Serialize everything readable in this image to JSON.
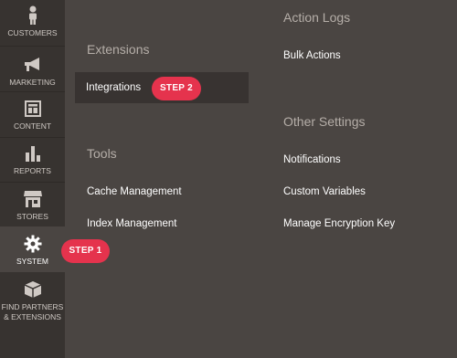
{
  "sidebar": {
    "items": [
      {
        "label": "CUSTOMERS",
        "icon": "person-icon"
      },
      {
        "label": "MARKETING",
        "icon": "megaphone-icon"
      },
      {
        "label": "CONTENT",
        "icon": "layout-icon"
      },
      {
        "label": "REPORTS",
        "icon": "bar-chart-icon"
      },
      {
        "label": "STORES",
        "icon": "storefront-icon"
      },
      {
        "label": "SYSTEM",
        "icon": "gear-icon"
      },
      {
        "label_line1": "FIND PARTNERS",
        "label_line2": "& EXTENSIONS",
        "icon": "box-icon"
      }
    ]
  },
  "panel": {
    "extensions": {
      "heading": "Extensions",
      "items": [
        "Integrations"
      ]
    },
    "tools": {
      "heading": "Tools",
      "items": [
        "Cache Management",
        "Index Management"
      ]
    },
    "action_logs": {
      "heading": "Action Logs",
      "items": [
        "Bulk Actions"
      ]
    },
    "other_settings": {
      "heading": "Other Settings",
      "items": [
        "Notifications",
        "Custom Variables",
        "Manage Encryption Key"
      ]
    }
  },
  "badges": {
    "step1": "STEP 1",
    "step2": "STEP 2"
  },
  "colors": {
    "sidebar_bg": "#373330",
    "panel_bg": "#4a4542",
    "badge": "#e5334d",
    "heading": "#b5aea8"
  }
}
